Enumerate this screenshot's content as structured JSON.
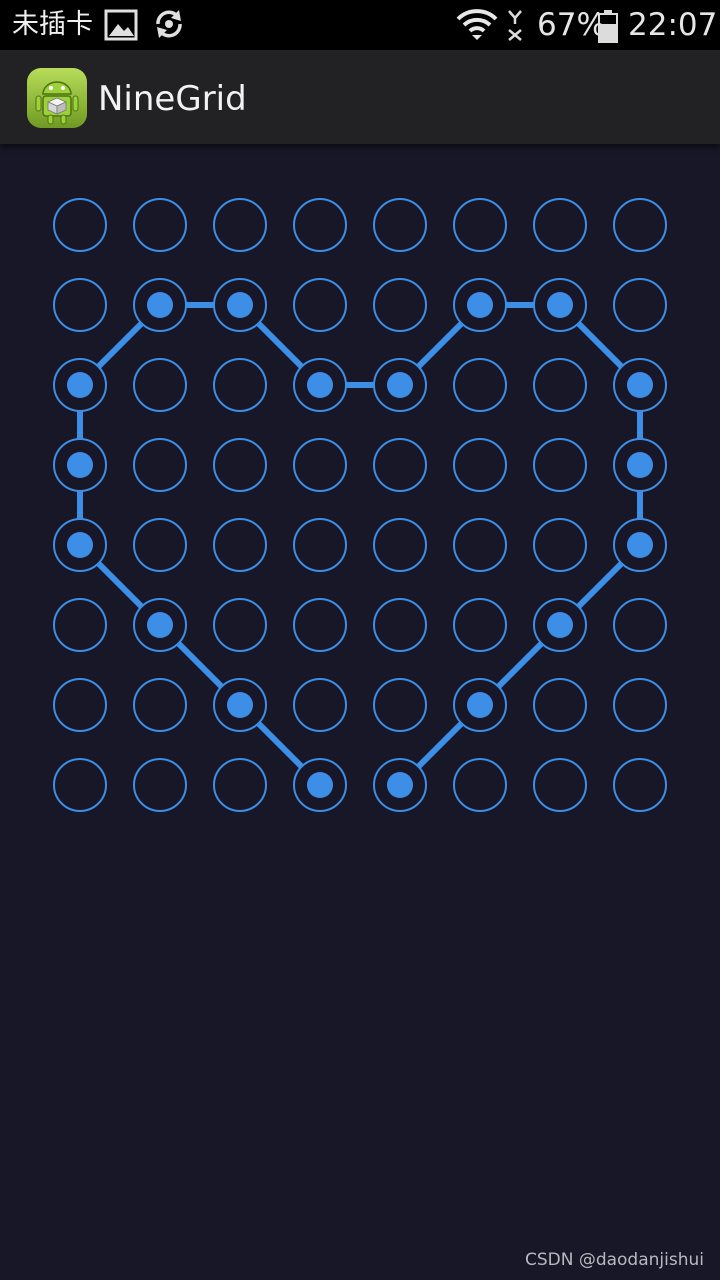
{
  "status_bar": {
    "carrier": "未插卡",
    "battery_percent": "67%",
    "time": "22:07",
    "battery_level": 0.67,
    "icons": [
      "image-icon",
      "sync-icon",
      "wifi-icon",
      "no-signal-icon",
      "battery-icon"
    ]
  },
  "action_bar": {
    "app_title": "NineGrid",
    "app_icon": "android-app-icon"
  },
  "pattern_grid": {
    "rows": 8,
    "cols": 8,
    "colors": {
      "background": "#171727",
      "ring": "#3d8ee6",
      "dot": "#3d8ee6",
      "line": "#3d8ee6"
    },
    "path": [
      [
        7,
        4
      ],
      [
        6,
        5
      ],
      [
        5,
        6
      ],
      [
        4,
        7
      ],
      [
        3,
        7
      ],
      [
        2,
        7
      ],
      [
        1,
        6
      ],
      [
        1,
        5
      ],
      [
        2,
        4
      ],
      [
        2,
        3
      ],
      [
        1,
        2
      ],
      [
        1,
        1
      ],
      [
        2,
        0
      ],
      [
        3,
        0
      ],
      [
        4,
        0
      ],
      [
        5,
        1
      ],
      [
        6,
        2
      ],
      [
        7,
        3
      ]
    ]
  },
  "watermark": "CSDN @daodanjishui"
}
